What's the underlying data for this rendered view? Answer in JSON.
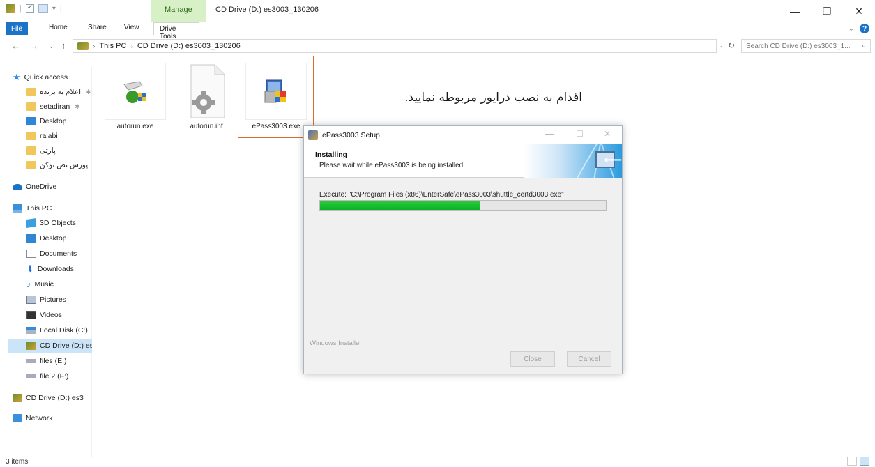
{
  "titlebar": {
    "manage_label": "Manage",
    "window_title": "CD Drive (D:) es3003_130206",
    "controls": {
      "minimize": "—",
      "maximize": "❐",
      "close": "✕"
    }
  },
  "ribbon": {
    "tabs": {
      "file": "File",
      "home": "Home",
      "share": "Share",
      "view": "View",
      "drive_tools": "Drive Tools"
    },
    "expand": "⌄",
    "help": "?"
  },
  "address": {
    "back": "←",
    "forward": "→",
    "recent": "⌄",
    "up": "↑",
    "sep": "›",
    "crumbs": [
      "This PC",
      "CD Drive (D:) es3003_130206"
    ],
    "dropdown": "⌄",
    "refresh": "↻",
    "search_placeholder": "Search CD Drive (D:) es3003_1...",
    "search_icon": "⌕"
  },
  "sidebar": {
    "quick_access": "Quick access",
    "items": [
      {
        "label": "اعلام به برنده"
      },
      {
        "label": "setadiran"
      },
      {
        "label": "Desktop"
      },
      {
        "label": "rajabi"
      },
      {
        "label": "پارتی"
      },
      {
        "label": "پوزش نص توکن"
      }
    ],
    "pin": "✱",
    "onedrive": "OneDrive",
    "this_pc": "This PC",
    "pc_items": [
      {
        "label": "3D Objects"
      },
      {
        "label": "Desktop"
      },
      {
        "label": "Documents"
      },
      {
        "label": "Downloads"
      },
      {
        "label": "Music"
      },
      {
        "label": "Pictures"
      },
      {
        "label": "Videos"
      },
      {
        "label": "Local Disk (C:)"
      },
      {
        "label": "CD Drive (D:) es"
      },
      {
        "label": "files (E:)"
      },
      {
        "label": "file 2 (F:)"
      }
    ],
    "cd_drive": "CD Drive (D:) es3",
    "network": "Network"
  },
  "files": [
    {
      "name": "autorun.exe",
      "icon": "setup-wizard-icon"
    },
    {
      "name": "autorun.inf",
      "icon": "settings-file-icon"
    },
    {
      "name": "ePass3003.exe",
      "icon": "installer-icon"
    }
  ],
  "instruction_text": "اقدام به نصب درایور مربوطه نمایید.",
  "dialog": {
    "title": "ePass3003 Setup",
    "min": "—",
    "max": "☐",
    "close": "✕",
    "heading": "Installing",
    "subheading": "Please wait while ePass3003 is being installed.",
    "execute_text": "Execute: \"C:\\Program Files (x86)\\EnterSafe\\ePass3003\\shuttle_certd3003.exe\"",
    "progress_fraction": 0.56,
    "footer_label": "Windows Installer",
    "close_button": "Close",
    "cancel_button": "Cancel"
  },
  "status": {
    "item_count": "3 items"
  }
}
